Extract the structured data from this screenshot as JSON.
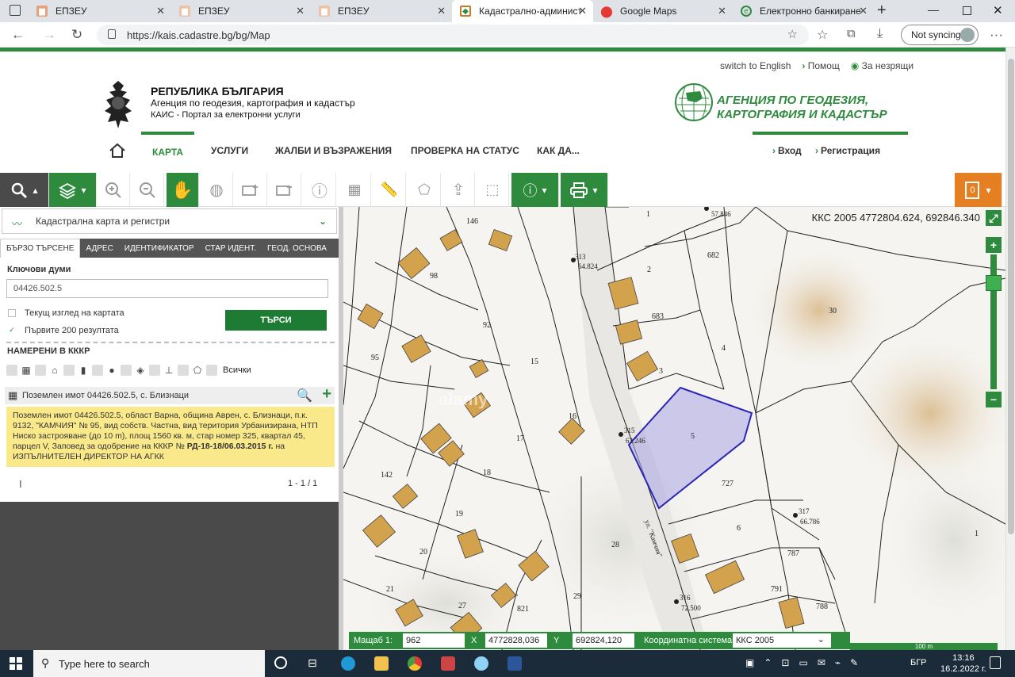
{
  "browser": {
    "tabs": [
      {
        "label": "ЕПЗЕУ",
        "icon": "epzeu-icon",
        "active": false
      },
      {
        "label": "ЕПЗЕУ",
        "icon": "epzeu-icon",
        "active": false
      },
      {
        "label": "ЕПЗЕУ",
        "icon": "epzeu-icon",
        "active": false
      },
      {
        "label": "Кадастрално-администра",
        "icon": "cadastre-icon",
        "active": true
      },
      {
        "label": "Google Maps",
        "icon": "google-maps-icon",
        "active": false
      },
      {
        "label": "Електронно банкиране Д",
        "icon": "bank-icon",
        "active": false
      }
    ],
    "url": "https://kais.cadastre.bg/bg/Map",
    "sync_label": "Not syncing"
  },
  "header": {
    "links": [
      "switch to English",
      "Помощ",
      "За незрящи"
    ],
    "org_line1": "РЕПУБЛИКА БЪЛГАРИЯ",
    "org_line2": "Агенция по геодезия, картография и кадастър",
    "org_line3": "КАИС - Портал за електронни услуги",
    "logo_text": "АГЕНЦИЯ ПО ГЕОДЕЗИЯ, КАРТОГРАФИЯ И КАДАСТЪР",
    "nav": [
      "КАРТА",
      "УСЛУГИ",
      "ЖАЛБИ И ВЪЗРАЖЕНИЯ",
      "ПРОВЕРКА НА СТАТУС",
      "КАК ДА..."
    ],
    "login": "Вход",
    "register": "Регистрация"
  },
  "toolbar": {
    "cart_count": "0"
  },
  "panel": {
    "title": "Кадастрална карта и регистри",
    "tabs": [
      "БЪРЗО ТЪРСЕНЕ",
      "АДРЕС",
      "ИДЕНТИФИКАТОР",
      "СТАР ИДЕНТ.",
      "ГЕОД. ОСНОВА"
    ],
    "keywords_label": "Ключови думи",
    "keywords_value": "04426.502.5",
    "check1": "Текущ изглед на картата",
    "check2": "Първите 200 резултата",
    "search_button": "ТЪРСИ",
    "found_label": "НАМЕРЕНИ В КККР",
    "filter_all": "Всички",
    "result_title": "Поземлен имот 04426.502.5, с. Близнаци",
    "result_info_a": "Поземлен имот 04426.502.5, област Варна, община Аврен, с. Близнаци, п.к. 9132, \"КАМЧИЯ\" № 95, вид собств. Частна, вид територия Урбанизирана, НТП Ниско застрояване (до 10 m), площ 1560 кв. м, стар номер 325, квартал 45, парцел V, Заповед за одобрение на КККР № ",
    "result_info_b": "РД-18-18/06.03.2015 г.",
    "result_info_c": " на ИЗПЪЛНИТЕЛЕН ДИРЕКТОР НА АГКК",
    "pager": "1 - 1 / 1"
  },
  "map": {
    "coords": "ККС 2005 4772804.624, 692846.340",
    "watermark": "alamy",
    "labels": [
      "1",
      "146",
      "98",
      "92",
      "95",
      "15",
      "16",
      "17",
      "18",
      "19",
      "20",
      "21",
      "27",
      "821",
      "29",
      "28",
      "142",
      "2",
      "683",
      "3",
      "4",
      "682",
      "30",
      "5",
      "727",
      "6",
      "787",
      "791",
      "788",
      "1"
    ],
    "points": [
      {
        "id": "313",
        "h": "64.824"
      },
      {
        "id": "315",
        "h": "63.246"
      },
      {
        "id": "316",
        "h": "72.500"
      },
      {
        "id": "317",
        "h": "66.786"
      },
      {
        "id": "",
        "h": "57.846"
      }
    ],
    "street": "ул. \"Камчия\""
  },
  "statusbar": {
    "scale_label": "Мащаб 1:",
    "scale_value": "962",
    "x_label": "X",
    "x_value": "4772828,036",
    "y_label": "Y",
    "y_value": "692824,120",
    "cs_label": "Координатна система",
    "cs_value": "ККС 2005",
    "scalebar": "100 m"
  },
  "taskbar": {
    "search_placeholder": "Type here to search",
    "lang": "БГР",
    "time": "13:16",
    "date": "16.2.2022 г."
  }
}
